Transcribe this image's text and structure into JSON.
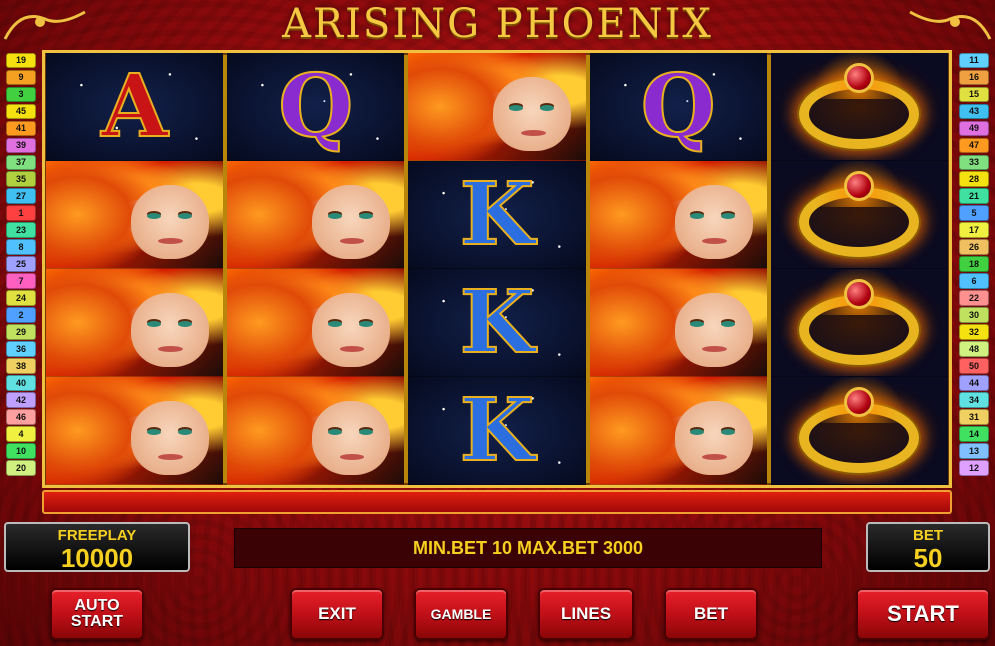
{
  "title": "ARISING PHOENIX",
  "lines_left": [
    {
      "n": "19",
      "c": "#f5e010"
    },
    {
      "n": "9",
      "c": "#f5a020"
    },
    {
      "n": "3",
      "c": "#40d040"
    },
    {
      "n": "45",
      "c": "#f5e010"
    },
    {
      "n": "41",
      "c": "#ff9a20"
    },
    {
      "n": "39",
      "c": "#e070e0"
    },
    {
      "n": "37",
      "c": "#80e080"
    },
    {
      "n": "35",
      "c": "#b0d040"
    },
    {
      "n": "27",
      "c": "#40c0f0"
    },
    {
      "n": "1",
      "c": "#ff4040"
    },
    {
      "n": "23",
      "c": "#40e0a0"
    },
    {
      "n": "8",
      "c": "#50c0ff"
    },
    {
      "n": "25",
      "c": "#a0a0ff"
    },
    {
      "n": "7",
      "c": "#ff60c0"
    },
    {
      "n": "24",
      "c": "#e0e040"
    },
    {
      "n": "2",
      "c": "#50a0ff"
    },
    {
      "n": "29",
      "c": "#c0e060"
    },
    {
      "n": "36",
      "c": "#60d0ff"
    },
    {
      "n": "38",
      "c": "#f0d060"
    },
    {
      "n": "40",
      "c": "#60e0e0"
    },
    {
      "n": "42",
      "c": "#c0a0ff"
    },
    {
      "n": "46",
      "c": "#ffa0a0"
    },
    {
      "n": "4",
      "c": "#f0f040"
    },
    {
      "n": "10",
      "c": "#40e060"
    },
    {
      "n": "20",
      "c": "#d0f080"
    }
  ],
  "lines_right": [
    {
      "n": "11",
      "c": "#60d0ff"
    },
    {
      "n": "16",
      "c": "#f0a040"
    },
    {
      "n": "15",
      "c": "#e0e040"
    },
    {
      "n": "43",
      "c": "#40c0f0"
    },
    {
      "n": "49",
      "c": "#e070e0"
    },
    {
      "n": "47",
      "c": "#ff9a20"
    },
    {
      "n": "33",
      "c": "#80e080"
    },
    {
      "n": "28",
      "c": "#f5e010"
    },
    {
      "n": "21",
      "c": "#40e0a0"
    },
    {
      "n": "5",
      "c": "#50a0ff"
    },
    {
      "n": "17",
      "c": "#f0f040"
    },
    {
      "n": "26",
      "c": "#f0c060"
    },
    {
      "n": "18",
      "c": "#40d040"
    },
    {
      "n": "6",
      "c": "#50c0ff"
    },
    {
      "n": "22",
      "c": "#ff9090"
    },
    {
      "n": "30",
      "c": "#c0e060"
    },
    {
      "n": "32",
      "c": "#f5e010"
    },
    {
      "n": "48",
      "c": "#d0f080"
    },
    {
      "n": "50",
      "c": "#ff6060"
    },
    {
      "n": "44",
      "c": "#a0a0ff"
    },
    {
      "n": "34",
      "c": "#60e0e0"
    },
    {
      "n": "31",
      "c": "#f0d060"
    },
    {
      "n": "14",
      "c": "#40e060"
    },
    {
      "n": "13",
      "c": "#80c0ff"
    },
    {
      "n": "12",
      "c": "#e0a0ff"
    }
  ],
  "reels": [
    [
      "A",
      "woman",
      "woman",
      "woman"
    ],
    [
      "Q",
      "woman",
      "woman",
      "woman"
    ],
    [
      "woman",
      "K",
      "K",
      "K"
    ],
    [
      "Q",
      "woman",
      "woman",
      "woman"
    ],
    [
      "ring",
      "ring",
      "ring",
      "ring"
    ]
  ],
  "freeplay": {
    "label": "FREEPLAY",
    "value": "10000"
  },
  "bet": {
    "label": "BET",
    "value": "50"
  },
  "message": "MIN.BET 10 MAX.BET 3000",
  "buttons": {
    "auto_start_line1": "AUTO",
    "auto_start_line2": "START",
    "exit": "EXIT",
    "gamble": "GAMBLE",
    "lines": "LINES",
    "bet": "BET",
    "start": "START"
  }
}
